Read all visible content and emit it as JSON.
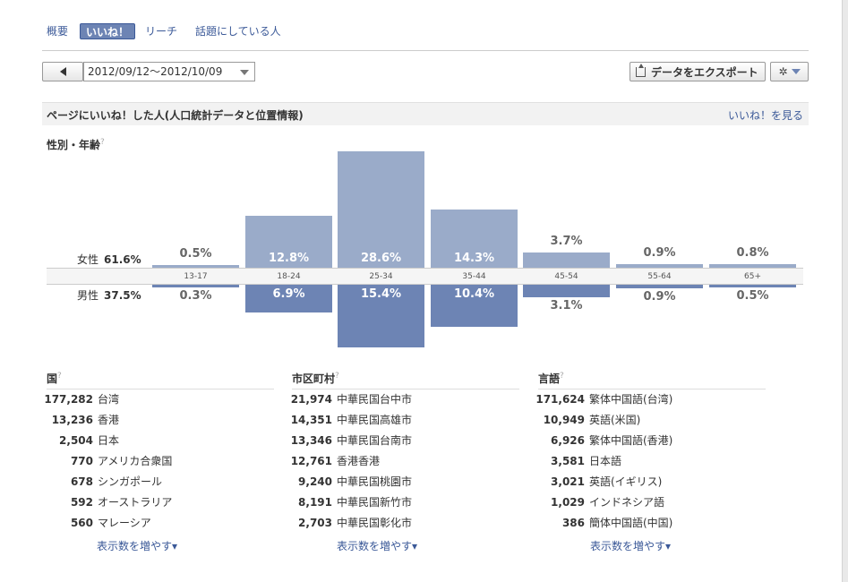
{
  "tabs": [
    "概要",
    "いいね！",
    "リーチ",
    "話題にしている人"
  ],
  "toolbar": {
    "date_range": "2012/09/12〜2012/10/09",
    "export_label": "データをエクスポート"
  },
  "section": {
    "title": "ページにいいね！した人(人口統計データと位置情報)",
    "link": "いいね！を見る"
  },
  "gender_age": {
    "label": "性別・年齢",
    "female_label": "女性",
    "female_total": "61.6%",
    "male_label": "男性",
    "male_total": "37.5%"
  },
  "chart_data": {
    "type": "bar",
    "categories": [
      "13-17",
      "18-24",
      "25-34",
      "35-44",
      "45-54",
      "55-64",
      "65+"
    ],
    "series": [
      {
        "name": "女性",
        "values": [
          0.5,
          12.8,
          28.6,
          14.3,
          3.7,
          0.9,
          0.8
        ],
        "labels": [
          "0.5%",
          "12.8%",
          "28.6%",
          "14.3%",
          "3.7%",
          "0.9%",
          "0.8%"
        ],
        "color": "#9aabc9"
      },
      {
        "name": "男性",
        "values": [
          0.3,
          6.9,
          15.4,
          10.4,
          3.1,
          0.9,
          0.5
        ],
        "labels": [
          "0.3%",
          "6.9%",
          "15.4%",
          "10.4%",
          "3.1%",
          "0.9%",
          "0.5%"
        ],
        "color": "#6d84b4"
      }
    ]
  },
  "countries": {
    "title": "国",
    "items": [
      {
        "count": "177,282",
        "name": "台湾"
      },
      {
        "count": "13,236",
        "name": "香港"
      },
      {
        "count": "2,504",
        "name": "日本"
      },
      {
        "count": "770",
        "name": "アメリカ合衆国"
      },
      {
        "count": "678",
        "name": "シンガポール"
      },
      {
        "count": "592",
        "name": "オーストラリア"
      },
      {
        "count": "560",
        "name": "マレーシア"
      }
    ],
    "more": "表示数を増やす▾"
  },
  "cities": {
    "title": "市区町村",
    "items": [
      {
        "count": "21,974",
        "name": "中華民国台中市"
      },
      {
        "count": "14,351",
        "name": "中華民国高雄市"
      },
      {
        "count": "13,346",
        "name": "中華民国台南市"
      },
      {
        "count": "12,761",
        "name": "香港香港"
      },
      {
        "count": "9,240",
        "name": "中華民国桃園市"
      },
      {
        "count": "8,191",
        "name": "中華民国新竹市"
      },
      {
        "count": "2,703",
        "name": "中華民国彰化市"
      }
    ],
    "more": "表示数を増やす▾"
  },
  "languages": {
    "title": "言語",
    "items": [
      {
        "count": "171,624",
        "name": "繁体中国語(台湾)"
      },
      {
        "count": "10,949",
        "name": "英語(米国)"
      },
      {
        "count": "6,926",
        "name": "繁体中国語(香港)"
      },
      {
        "count": "3,581",
        "name": "日本語"
      },
      {
        "count": "3,021",
        "name": "英語(イギリス)"
      },
      {
        "count": "1,029",
        "name": "インドネシア語"
      },
      {
        "count": "386",
        "name": "簡体中国語(中国)"
      }
    ],
    "more": "表示数を増やす▾"
  }
}
